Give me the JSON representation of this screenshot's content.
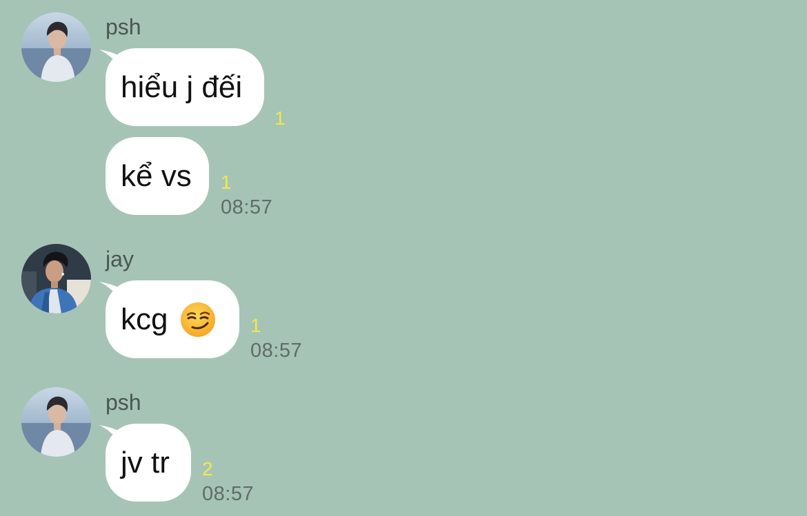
{
  "messages": [
    {
      "sender": "psh",
      "avatar": "avatar-psh",
      "bubbles": [
        {
          "text": "hiểu j đếi",
          "unread": "1",
          "time": ""
        },
        {
          "text": "kể vs",
          "unread": "1",
          "time": "08:57"
        }
      ]
    },
    {
      "sender": "jay",
      "avatar": "avatar-jay",
      "bubbles": [
        {
          "text": "kcg",
          "emoji": "smirking-face-icon",
          "unread": "1",
          "time": "08:57"
        }
      ]
    },
    {
      "sender": "psh",
      "avatar": "avatar-psh",
      "bubbles": [
        {
          "text": "jv tr",
          "unread": "2",
          "time": "08:57"
        }
      ]
    }
  ],
  "colors": {
    "background": "#a6c4b6",
    "bubble": "#ffffff",
    "unread": "#f2e84a",
    "timestamp": "#5f6c66",
    "sender_name": "#4a5651"
  }
}
